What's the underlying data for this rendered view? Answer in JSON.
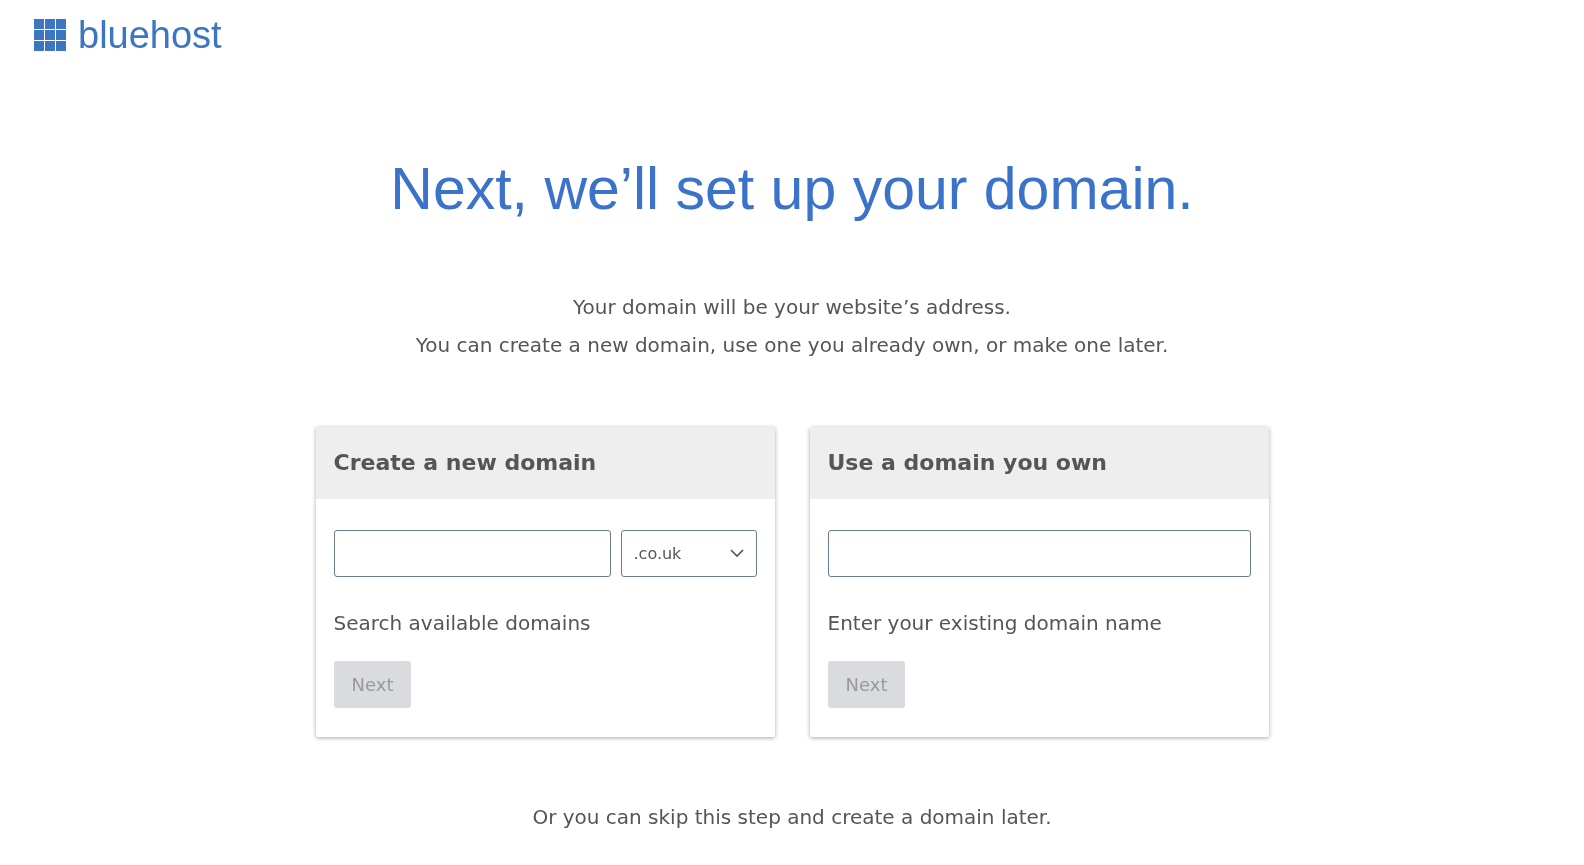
{
  "logo": {
    "text": "bluehost"
  },
  "heading": "Next, we’ll set up your domain.",
  "intro": [
    "Your domain will be your website’s address.",
    "You can create a new domain, use one you already own, or make one later."
  ],
  "cards": [
    {
      "kind": "search",
      "title": "Create a new domain",
      "tld": {
        "value": ".co.uk"
      },
      "hint": "Search available domains",
      "button": {
        "label": "Next",
        "disabled": true
      }
    },
    {
      "kind": "own",
      "title": "Use a domain you own",
      "hint": "Enter your existing domain name",
      "button": {
        "label": "Next",
        "disabled": true
      }
    }
  ],
  "skip_text": "Or you can skip this step and create a domain later."
}
